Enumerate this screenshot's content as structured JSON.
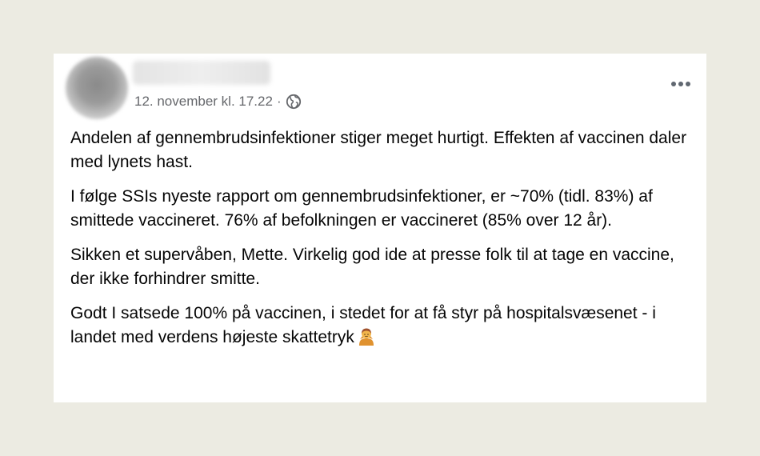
{
  "post": {
    "timestamp": "12. november kl. 17.22",
    "separator": "·",
    "privacy_icon": "globe-icon",
    "more_icon": "more-horizontal-icon",
    "paragraphs": [
      "Andelen af gennembrudsinfektioner stiger meget hurtigt. Effekten af vaccinen daler med lynets hast.",
      "I følge SSIs nyeste rapport om gennembrudsinfektioner, er ~70% (tidl. 83%) af smittede vaccineret. 76% af befolkningen er vaccineret (85% over 12 år).",
      "Sikken et supervåben, Mette. Virkelig god ide at presse folk til at tage en vaccine, der ikke forhindrer smitte.",
      "Godt I satsede 100% på vaccinen, i stedet for at få styr på hospitalsvæsenet - i landet med verdens højeste skattetryk"
    ],
    "trailing_emoji": "person-shrugging-emoji"
  },
  "colors": {
    "page_background": "#ecebe2",
    "card_background": "#ffffff",
    "text_primary": "#050505",
    "text_secondary": "#65676b"
  }
}
